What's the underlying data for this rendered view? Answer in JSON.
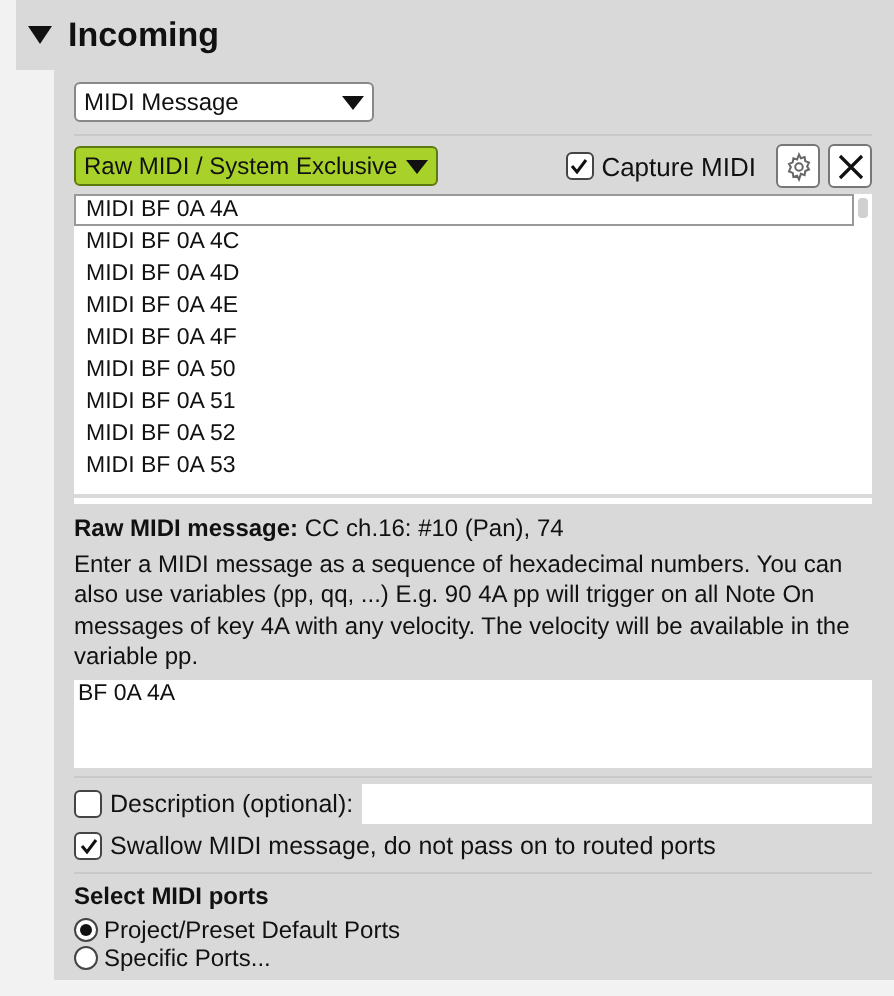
{
  "section": {
    "title": "Incoming",
    "expanded": true
  },
  "type_select": {
    "value": "MIDI Message"
  },
  "message_kind_select": {
    "value": "Raw MIDI / System Exclusive"
  },
  "capture_midi": {
    "label": "Capture MIDI",
    "checked": true
  },
  "captured_messages": [
    {
      "label": "MIDI BF 0A 4A",
      "selected": true
    },
    {
      "label": "MIDI BF 0A 4C",
      "selected": false
    },
    {
      "label": "MIDI BF 0A 4D",
      "selected": false
    },
    {
      "label": "MIDI BF 0A 4E",
      "selected": false
    },
    {
      "label": "MIDI BF 0A 4F",
      "selected": false
    },
    {
      "label": "MIDI BF 0A 50",
      "selected": false
    },
    {
      "label": "MIDI BF 0A 51",
      "selected": false
    },
    {
      "label": "MIDI BF 0A 52",
      "selected": false
    },
    {
      "label": "MIDI BF 0A 53",
      "selected": false
    }
  ],
  "raw_message": {
    "label": "Raw MIDI message:",
    "value": "CC ch.16:  #10 (Pan), 74"
  },
  "help_text": "Enter a MIDI message as a sequence of hexadecimal numbers. You can also use variables (pp, qq, ...) E.g. 90 4A pp will trigger on all Note On messages of key 4A with any velocity. The velocity will be available in the variable pp.",
  "message_input": {
    "value": "BF 0A 4A"
  },
  "description": {
    "label": "Description (optional):",
    "checked": false
  },
  "swallow": {
    "label": "Swallow MIDI message, do not pass on to routed ports",
    "checked": true
  },
  "ports": {
    "title": "Select MIDI ports",
    "options": [
      {
        "label": "Project/Preset Default Ports",
        "selected": true
      },
      {
        "label": "Specific Ports...",
        "selected": false
      }
    ]
  }
}
